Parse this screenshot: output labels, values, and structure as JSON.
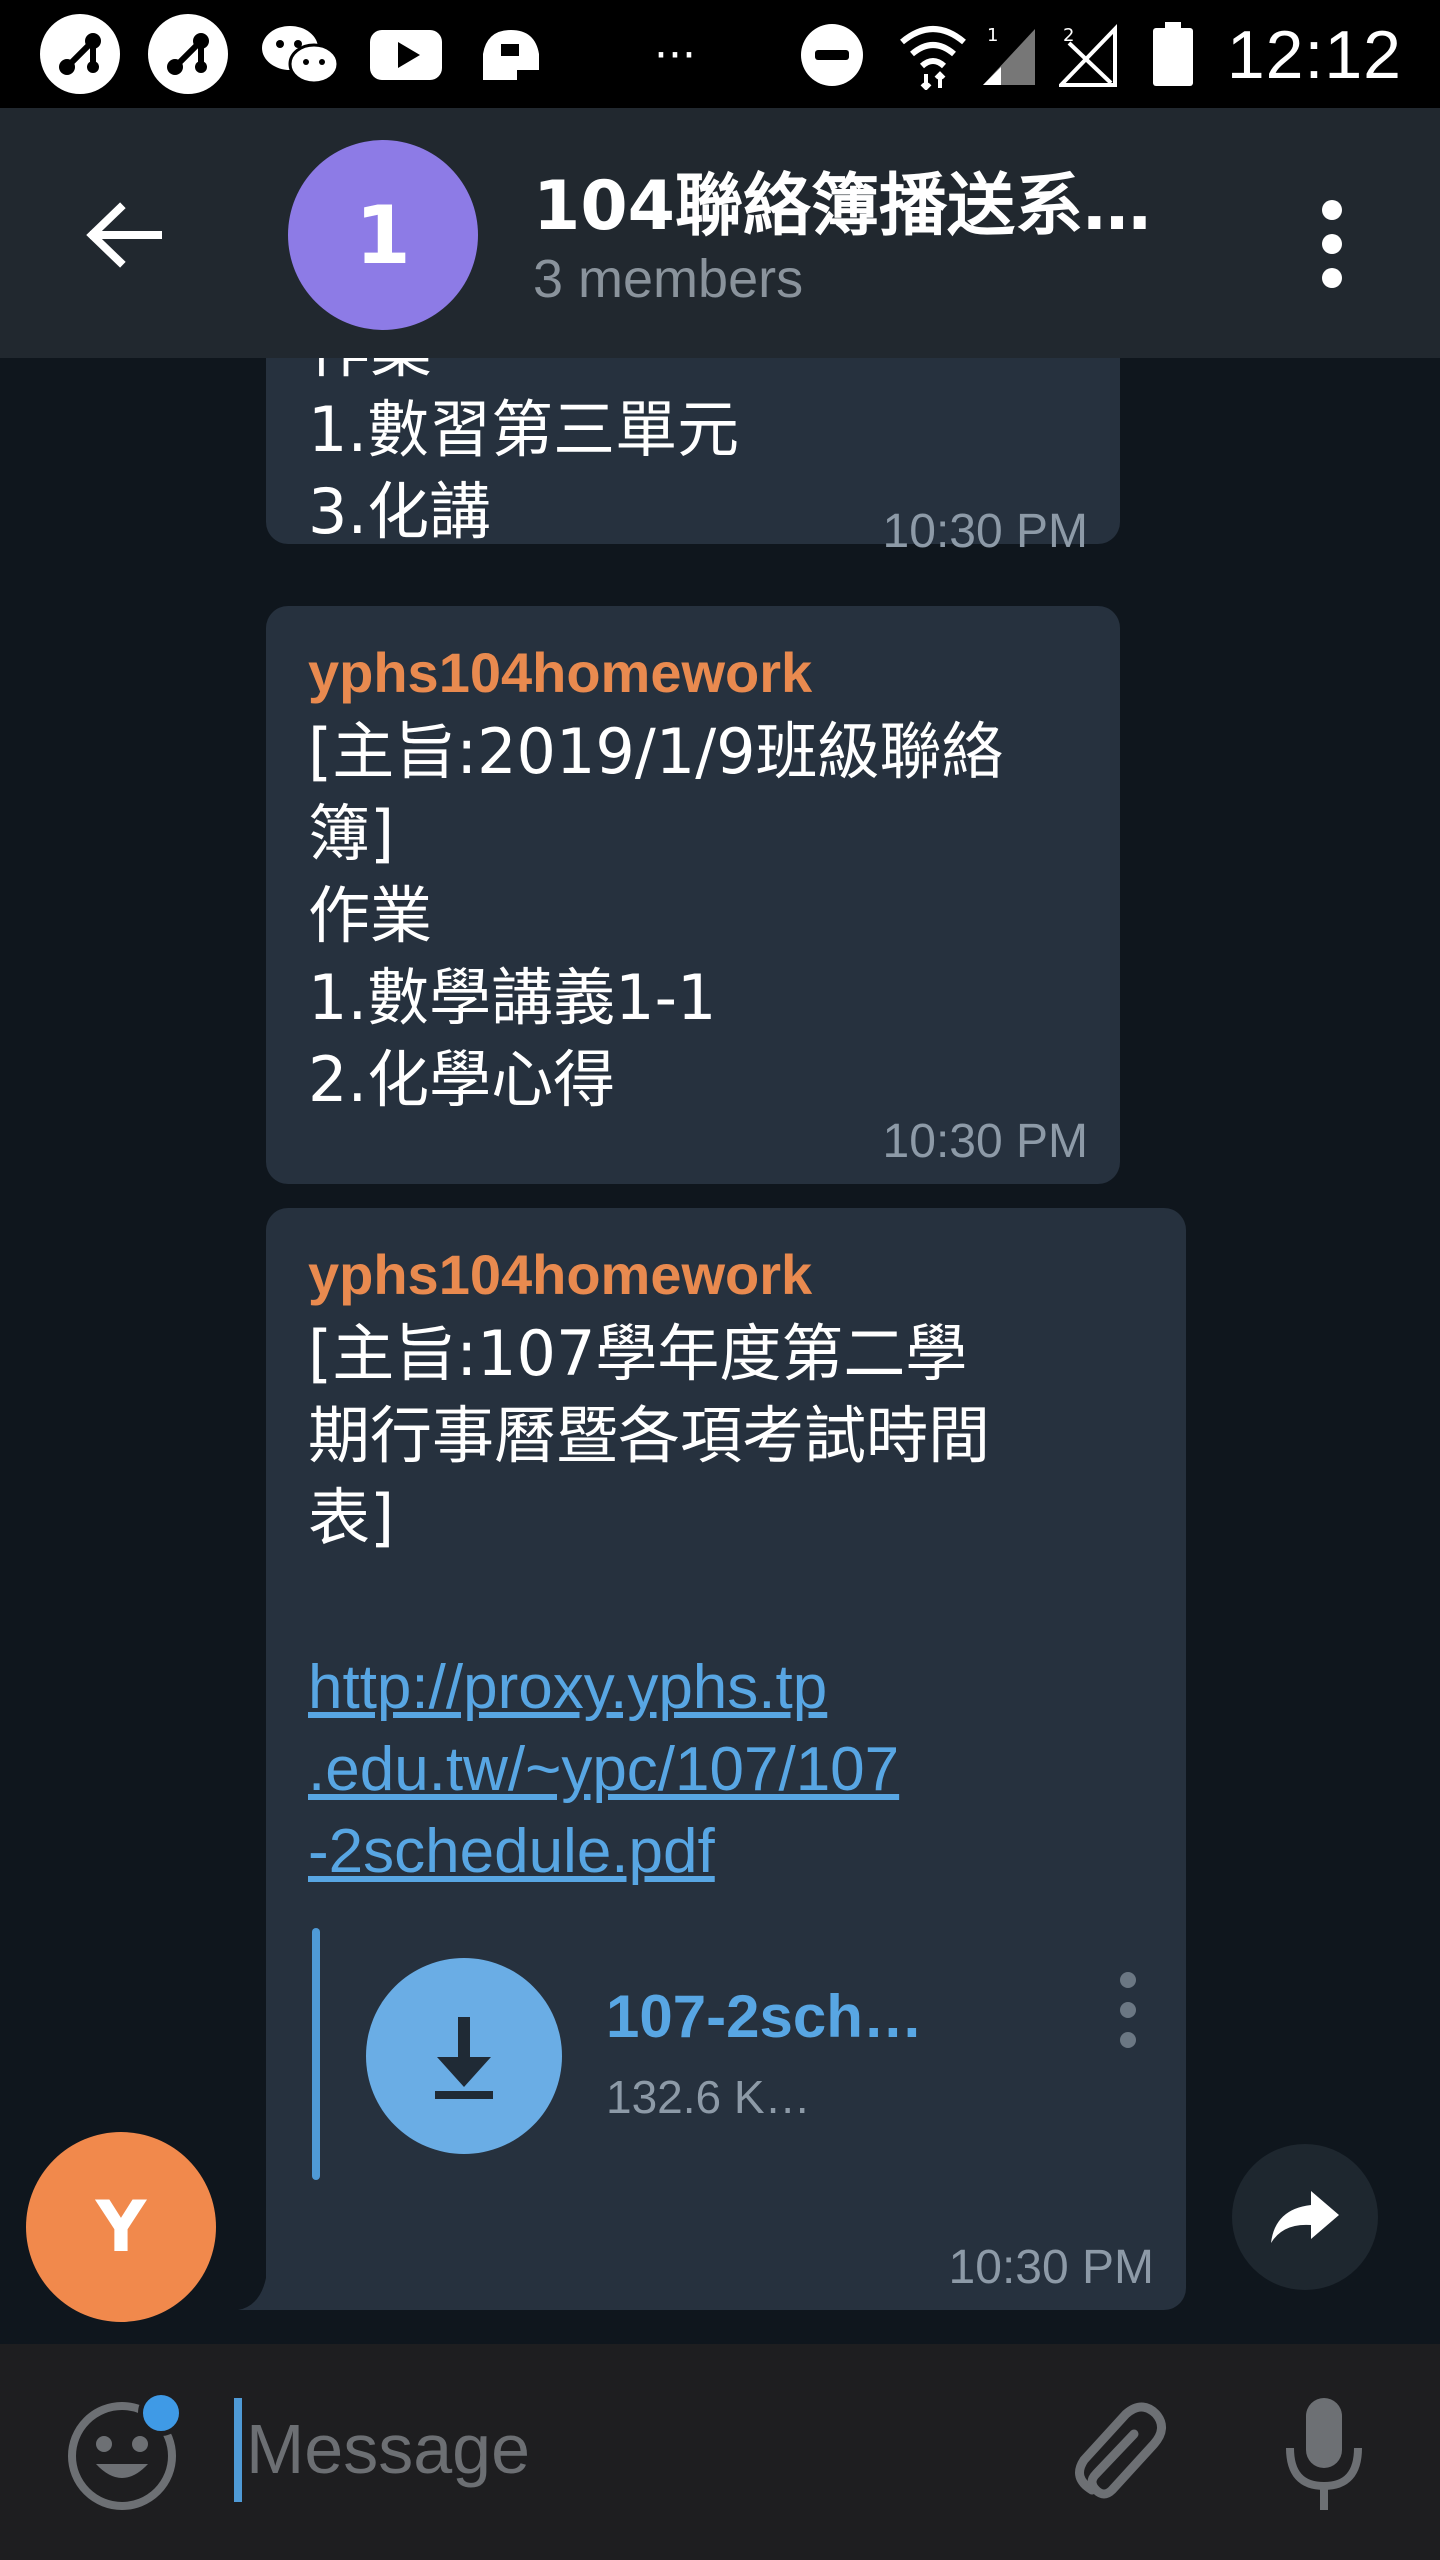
{
  "status_bar": {
    "time": "12:12",
    "icons": [
      "app-icon",
      "app-icon",
      "wechat-icon",
      "youtube-icon",
      "game-icon",
      "more-icon",
      "do-not-disturb-icon",
      "wifi-icon",
      "signal-icon",
      "signal-off-icon",
      "battery-icon"
    ],
    "more": "···"
  },
  "header": {
    "avatar_letter": "1",
    "title": "104聯絡簿播送系…",
    "subtitle": "3 members",
    "avatar_color": "#8d7be6"
  },
  "messages": [
    {
      "sender": "",
      "lines": [
        "作業",
        "1.數習第三單元",
        "3.化講"
      ],
      "time": "10:30 PM"
    },
    {
      "sender": "yphs104homework",
      "lines": [
        "[主旨:2019/1/9班級聯絡",
        "簿]",
        "作業",
        "1.數學講義1-1",
        "2.化學心得"
      ],
      "time": "10:30 PM"
    },
    {
      "sender": "yphs104homework",
      "lines": [
        "[主旨:107學年度第二學",
        "期行事曆暨各項考試時間",
        "表]"
      ],
      "link_lines": [
        "http://proxy.yphs.tp",
        ".edu.tw/~ypc/107/107",
        "-2schedule.pdf"
      ],
      "file": {
        "name": "107-2sch…",
        "size": "132.6 K…"
      },
      "time": "10:30 PM"
    }
  ],
  "sender_avatar": {
    "letter": "Y",
    "color": "#f1894c"
  },
  "input_bar": {
    "placeholder": "Message"
  },
  "colors": {
    "accent": "#58a6e3",
    "sender_name": "#e98a4f",
    "bubble": "#26313e",
    "background": "#0f161d"
  }
}
